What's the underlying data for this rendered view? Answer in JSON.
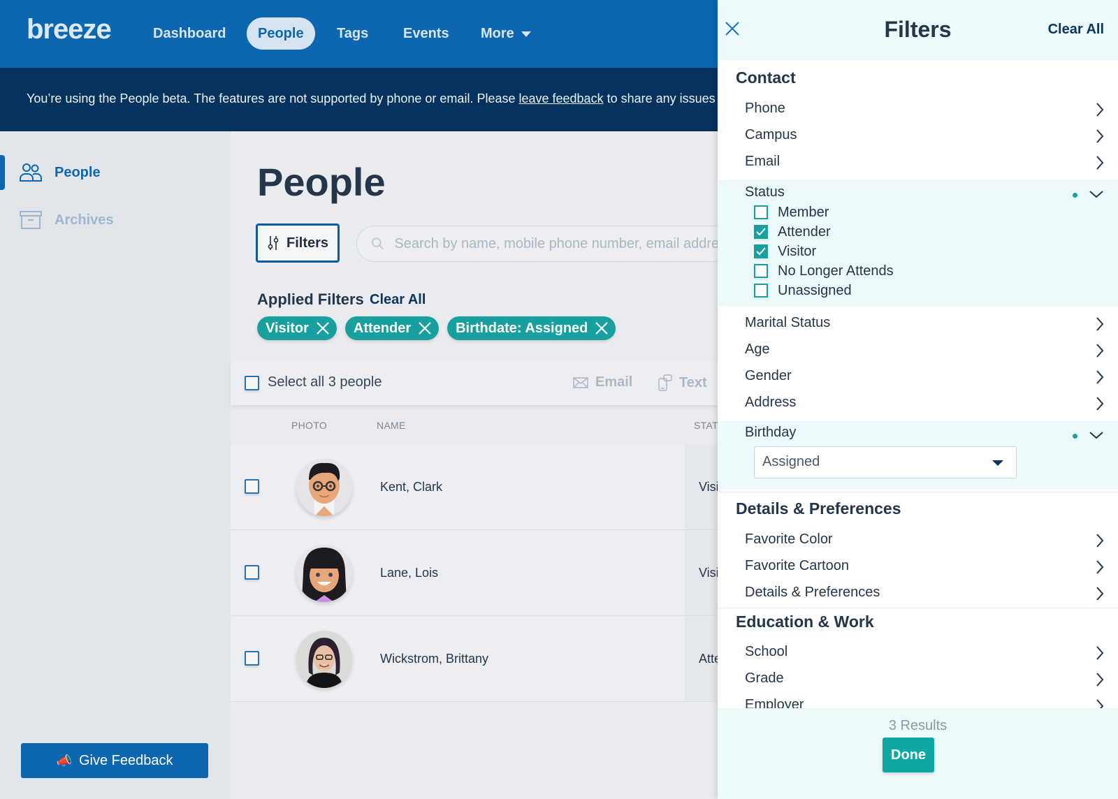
{
  "nav": {
    "logo": "breeze",
    "items": [
      {
        "label": "Dashboard",
        "active": false
      },
      {
        "label": "People",
        "active": true
      },
      {
        "label": "Tags",
        "active": false
      },
      {
        "label": "Events",
        "active": false
      },
      {
        "label": "More",
        "active": false,
        "has_dropdown": true
      }
    ]
  },
  "banner": {
    "text_before": "You’re using the People beta. The features are not supported by phone or email. Please ",
    "link": "leave feedback",
    "text_after": " to share any issues you"
  },
  "sidebar": {
    "items": [
      {
        "label": "People",
        "icon": "people-icon",
        "active": true
      },
      {
        "label": "Archives",
        "icon": "archive-box-icon",
        "active": false
      }
    ],
    "feedback_button": "Give Feedback",
    "feedback_icon": "megaphone-icon"
  },
  "main": {
    "title": "People",
    "filters_button": "Filters",
    "search_placeholder": "Search by name, mobile phone number, email address",
    "applied_filters_label": "Applied Filters",
    "clear_all": "Clear All",
    "chips": [
      "Visitor",
      "Attender",
      "Birthdate: Assigned"
    ],
    "select_all_label": "Select all 3 people",
    "actions": {
      "email": "Email",
      "text": "Text"
    },
    "columns": [
      "PHOTO",
      "NAME",
      "STATUS"
    ],
    "rows": [
      {
        "name": "Kent, Clark",
        "status": "Visitor",
        "avatar": "cartoon-man-glasses"
      },
      {
        "name": "Lane, Lois",
        "status": "Visitor",
        "avatar": "cartoon-woman"
      },
      {
        "name": "Wickstrom, Brittany",
        "status": "Attender",
        "avatar": "photo-woman-glasses"
      }
    ]
  },
  "panel": {
    "title": "Filters",
    "clear_all": "Clear All",
    "sections": [
      {
        "title": "Contact",
        "items": [
          "Phone",
          "Campus",
          "Email"
        ]
      }
    ],
    "status": {
      "label": "Status",
      "options": [
        {
          "label": "Member",
          "checked": false
        },
        {
          "label": "Attender",
          "checked": true
        },
        {
          "label": "Visitor",
          "checked": true
        },
        {
          "label": "No Longer Attends",
          "checked": false
        },
        {
          "label": "Unassigned",
          "checked": false
        }
      ]
    },
    "contact_more": [
      "Marital Status",
      "Age",
      "Gender",
      "Address"
    ],
    "birthday": {
      "label": "Birthday",
      "selected": "Assigned"
    },
    "details_title": "Details & Preferences",
    "details_items": [
      "Favorite Color",
      "Favorite Cartoon",
      "Details & Preferences"
    ],
    "education_title": "Education & Work",
    "education_items": [
      "School",
      "Grade",
      "Employer"
    ],
    "results": "3 Results",
    "done": "Done"
  },
  "colors": {
    "brand_blue": "#0d67b0",
    "banner_navy": "#06325e",
    "teal": "#17a09e",
    "panel_tint": "#ecfafb"
  }
}
